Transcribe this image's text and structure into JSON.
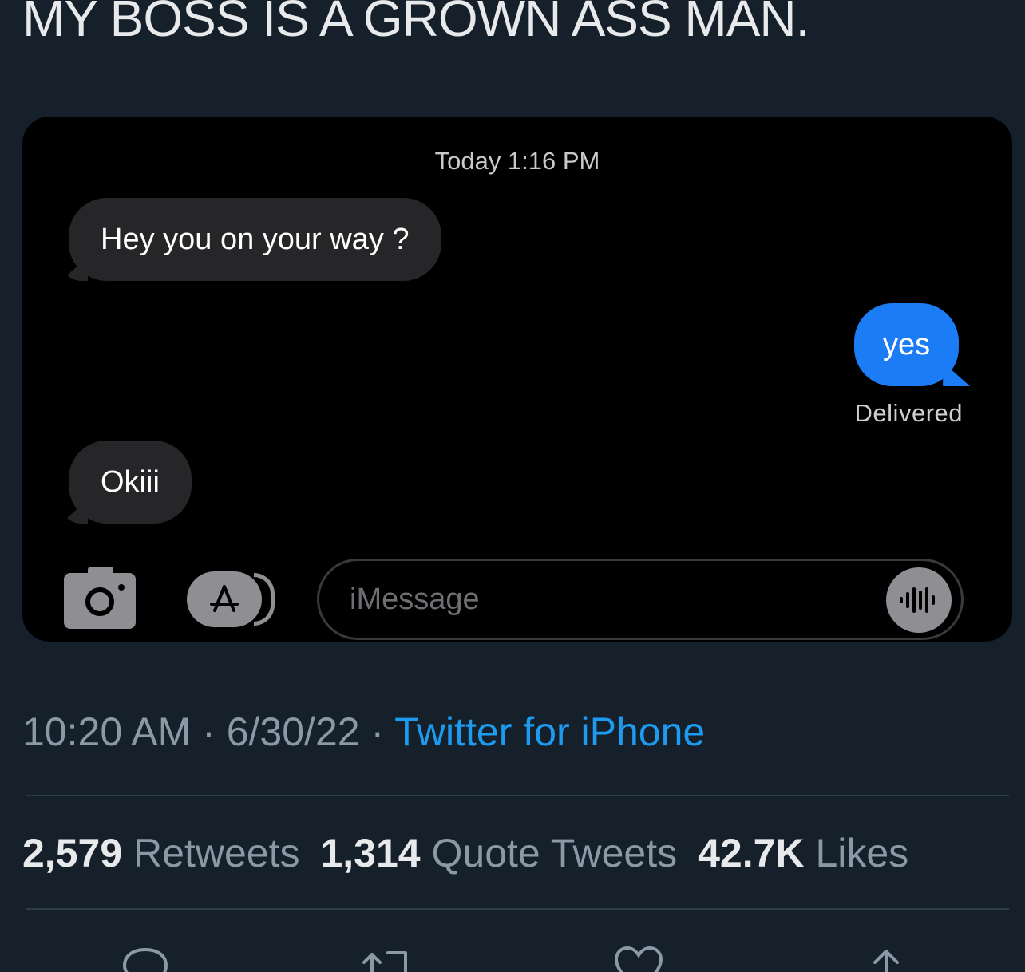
{
  "tweet": {
    "text": "MY BOSS IS A GROWN ASS MAN."
  },
  "messages_screenshot": {
    "timestamp": "Today 1:16 PM",
    "messages": [
      {
        "direction": "incoming",
        "text": "Hey you on your way ?"
      },
      {
        "direction": "outgoing",
        "text": "yes"
      },
      {
        "direction": "incoming",
        "text": "Okiii"
      }
    ],
    "delivery_status": "Delivered",
    "input": {
      "placeholder": "iMessage",
      "value": ""
    },
    "icons": [
      "camera-icon",
      "app-store-icon",
      "audio-waveform-icon"
    ]
  },
  "meta": {
    "time": "10:20 AM",
    "separator": "·",
    "date": "6/30/22",
    "source": "Twitter for iPhone"
  },
  "stats": {
    "retweets_count": "2,579",
    "retweets_label": "Retweets",
    "quotes_count": "1,314",
    "quotes_label": "Quote Tweets",
    "likes_count": "42.7K",
    "likes_label": "Likes"
  },
  "actions": [
    "reply-icon",
    "retweet-icon",
    "like-icon",
    "share-icon"
  ],
  "colors": {
    "background": "#15202b",
    "incoming_bubble": "#262628",
    "outgoing_bubble": "#1b7cf5",
    "link": "#1d9bf0"
  }
}
